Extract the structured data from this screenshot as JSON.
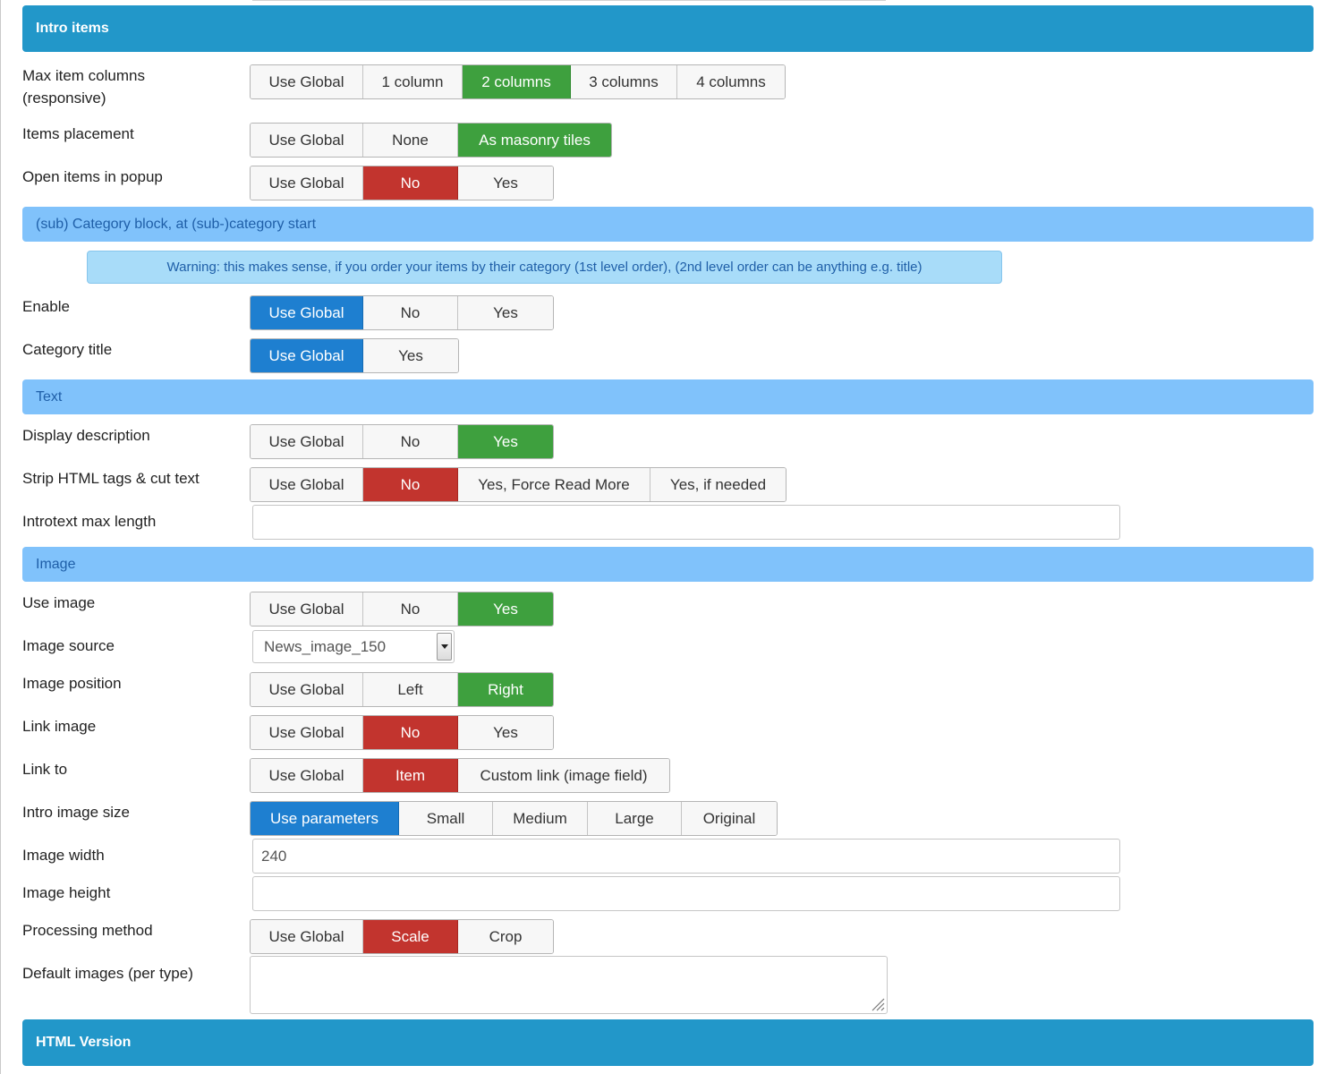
{
  "sections": {
    "intro_items": "Intro items",
    "category_block": "(sub) Category block, at (sub-)category start",
    "text": "Text",
    "image": "Image",
    "html_version": "HTML Version"
  },
  "warning": "Warning: this makes sense, if you order your items by their category (1st level order), (2nd level order can be anything e.g. title)",
  "labels": {
    "max_columns": "Max item columns (responsive)",
    "items_placement": "Items placement",
    "open_popup": "Open items in popup",
    "enable": "Enable",
    "category_title": "Category title",
    "display_description": "Display description",
    "strip_html": "Strip HTML tags & cut text",
    "introtext_max": "Introtext max length",
    "use_image": "Use image",
    "image_source": "Image source",
    "image_position": "Image position",
    "link_image": "Link image",
    "link_to": "Link to",
    "intro_image_size": "Intro image size",
    "image_width": "Image width",
    "image_height": "Image height",
    "processing_method": "Processing method",
    "default_images": "Default images (per type)"
  },
  "groups": {
    "max_columns": [
      "Use Global",
      "1 column",
      "2 columns",
      "3 columns",
      "4 columns"
    ],
    "items_placement": [
      "Use Global",
      "None",
      "As masonry tiles"
    ],
    "open_popup": [
      "Use Global",
      "No",
      "Yes"
    ],
    "enable": [
      "Use Global",
      "No",
      "Yes"
    ],
    "category_title": [
      "Use Global",
      "Yes"
    ],
    "display_description": [
      "Use Global",
      "No",
      "Yes"
    ],
    "strip_html": [
      "Use Global",
      "No",
      "Yes, Force Read More",
      "Yes, if needed"
    ],
    "use_image": [
      "Use Global",
      "No",
      "Yes"
    ],
    "image_position": [
      "Use Global",
      "Left",
      "Right"
    ],
    "link_image": [
      "Use Global",
      "No",
      "Yes"
    ],
    "link_to": [
      "Use Global",
      "Item",
      "Custom link (image field)"
    ],
    "intro_image_size": [
      "Use parameters",
      "Small",
      "Medium",
      "Large",
      "Original"
    ],
    "processing_method": [
      "Use Global",
      "Scale",
      "Crop"
    ]
  },
  "fields": {
    "introtext_max": "",
    "image_source": "News_image_150",
    "image_width": "240",
    "image_height": "",
    "default_images": ""
  },
  "colors": {
    "section_dark": "#2297c9",
    "section_light": "#80c2fb",
    "active_green": "#3ea03e",
    "active_red": "#c2342e",
    "active_blue": "#1e7fd0"
  }
}
